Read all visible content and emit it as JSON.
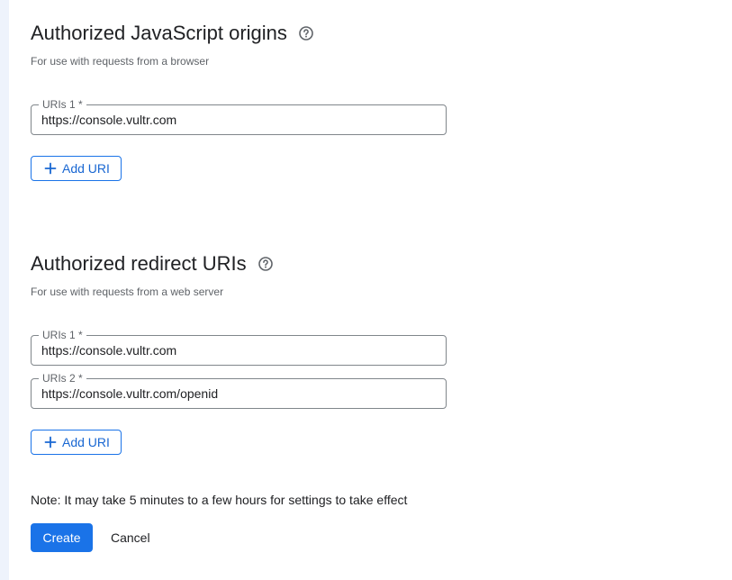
{
  "js_origins": {
    "title": "Authorized JavaScript origins",
    "subtitle": "For use with requests from a browser",
    "uris": [
      {
        "label": "URIs 1 *",
        "value": "https://console.vultr.com"
      }
    ],
    "add_label": "Add URI"
  },
  "redirect_uris": {
    "title": "Authorized redirect URIs",
    "subtitle": "For use with requests from a web server",
    "uris": [
      {
        "label": "URIs 1 *",
        "value": "https://console.vultr.com"
      },
      {
        "label": "URIs 2 *",
        "value": "https://console.vultr.com/openid"
      }
    ],
    "add_label": "Add URI"
  },
  "note": "Note: It may take 5 minutes to a few hours for settings to take effect",
  "actions": {
    "create_label": "Create",
    "cancel_label": "Cancel"
  },
  "colors": {
    "accent": "#1a73e8",
    "rail": "#eef3fc"
  },
  "icons": {
    "help": "help-circle-icon",
    "add": "plus-icon"
  }
}
